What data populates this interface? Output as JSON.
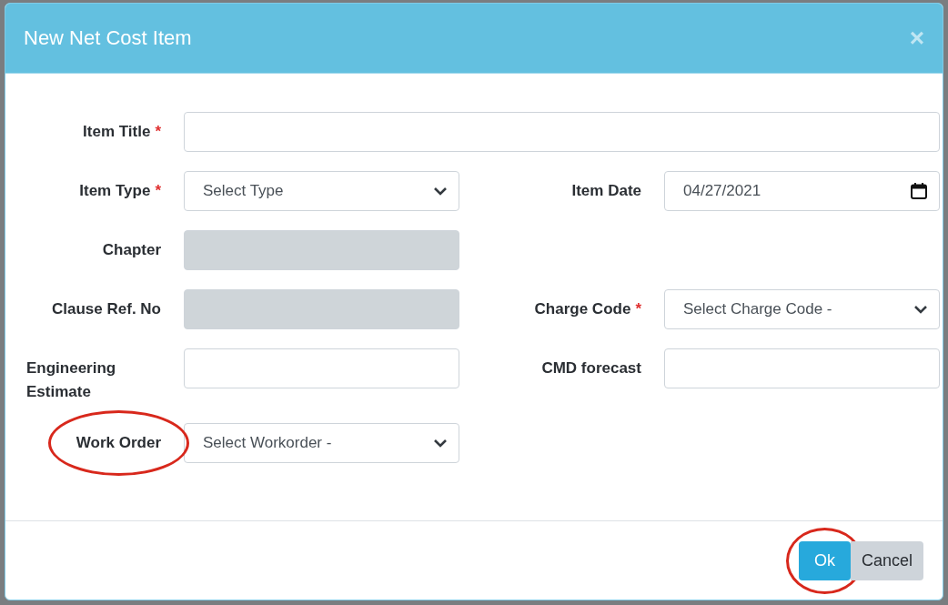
{
  "dialog": {
    "title": "New Net Cost Item",
    "close": "×"
  },
  "rows": [
    {
      "fields": [
        {
          "label": "Item Title",
          "required_mark": "*",
          "kind": "text",
          "full_width": true,
          "highlighted": false
        }
      ]
    },
    {
      "fields": [
        {
          "label": "Item Type",
          "required_mark": "*",
          "kind": "select",
          "value": "Select Type",
          "highlighted": false
        },
        {
          "label": "Item Date",
          "kind": "date",
          "value": "04/27/2021",
          "highlighted": false
        }
      ]
    },
    {
      "fields": [
        {
          "label": "Chapter",
          "kind": "text",
          "disabled": true,
          "highlighted": false
        }
      ]
    },
    {
      "fields": [
        {
          "label": "Clause Ref. No",
          "kind": "text",
          "disabled": true,
          "highlighted": false
        },
        {
          "label": "Charge Code",
          "required_mark": "*",
          "kind": "select",
          "value": "Select Charge Code -",
          "highlighted": false
        }
      ]
    },
    {
      "fields": [
        {
          "label": "Engineering Estimate",
          "kind": "text",
          "highlighted": false
        },
        {
          "label": "CMD forecast",
          "kind": "text",
          "highlighted": false
        }
      ]
    },
    {
      "fields": [
        {
          "label": "Work Order",
          "kind": "select",
          "value": "Select Workorder -",
          "highlighted": true
        }
      ]
    }
  ],
  "buttons": [
    {
      "label": "Ok",
      "kind": "primary",
      "highlighted": true
    },
    {
      "label": "Cancel",
      "kind": "secondary",
      "highlighted": false
    }
  ]
}
